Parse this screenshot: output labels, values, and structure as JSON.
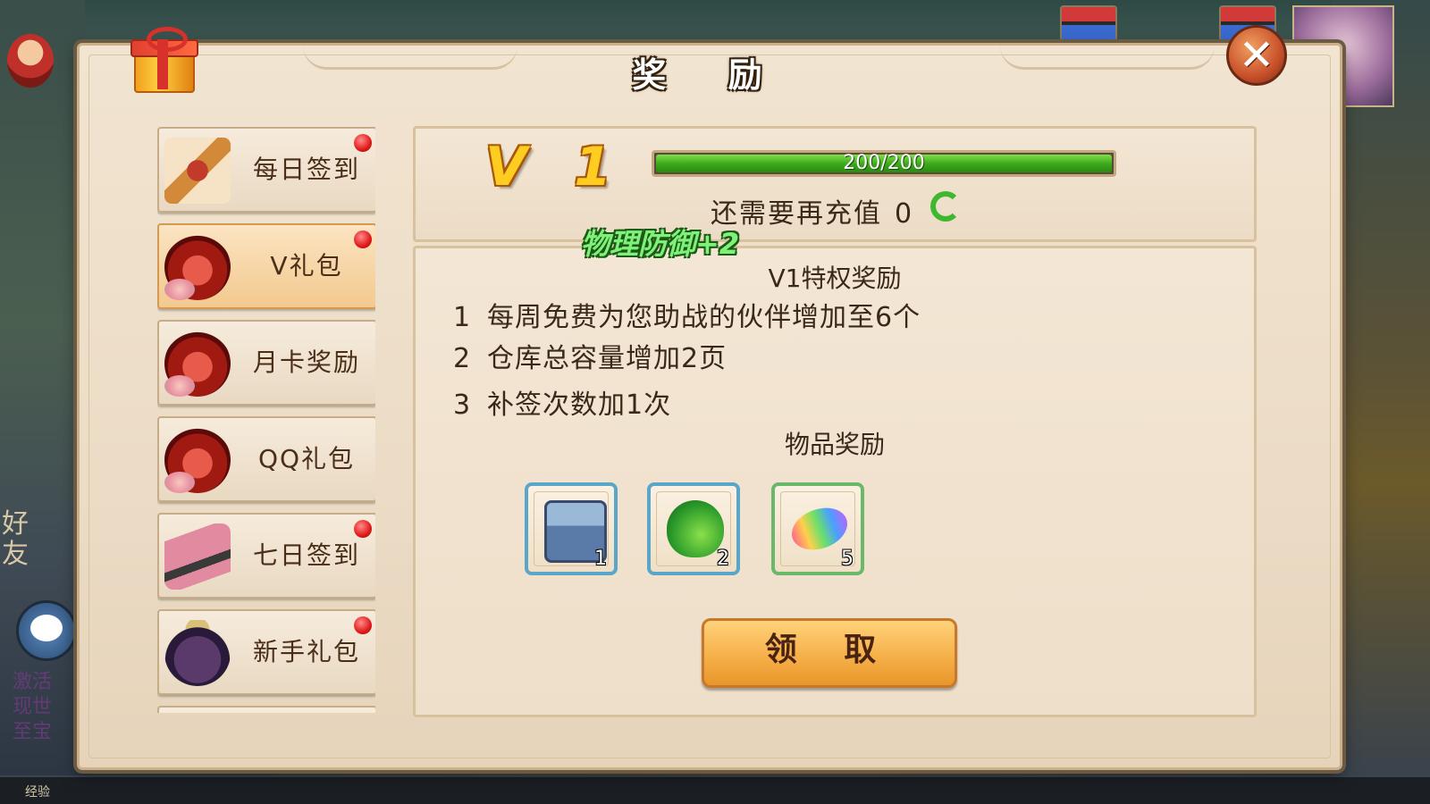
{
  "hud": {
    "exp_label": "经验",
    "side_text": "好友",
    "chat_log": [
      "激活",
      "现世",
      "至宝"
    ]
  },
  "dialog": {
    "title": "奖 励",
    "close_symbol": "✕"
  },
  "sidebar": {
    "items": [
      {
        "label": "每日签到",
        "icon": "scroll-icon",
        "badge": true,
        "active": false
      },
      {
        "label": "V礼包",
        "icon": "pot-icon",
        "badge": true,
        "active": true
      },
      {
        "label": "月卡奖励",
        "icon": "pot-icon",
        "badge": false,
        "active": false
      },
      {
        "label": "QQ礼包",
        "icon": "pot-icon",
        "badge": false,
        "active": false
      },
      {
        "label": "七日签到",
        "icon": "roll-icon",
        "badge": true,
        "active": false
      },
      {
        "label": "新手礼包",
        "icon": "bag-icon",
        "badge": true,
        "active": false
      }
    ]
  },
  "vip": {
    "level": "V 1",
    "progress_text": "200/200",
    "progress_fraction": 1.0,
    "recharge_label": "还需要再充值",
    "recharge_value": "0"
  },
  "floating_buff": "物理防御+2",
  "privileges": {
    "title": "V1特权奖励",
    "lines": [
      {
        "num": "1",
        "text": "每周免费为您助战的伙伴增加至6个"
      },
      {
        "num": "2",
        "text": "仓库总容量增加2页"
      },
      {
        "num": "3",
        "text": "补签次数加1次"
      }
    ]
  },
  "items_reward": {
    "title": "物品奖励",
    "items": [
      {
        "icon": "treasure-chest-icon",
        "count": "1",
        "frame": "blue"
      },
      {
        "icon": "gourd-icon",
        "count": "2",
        "frame": "blue"
      },
      {
        "icon": "rainbow-bean-icon",
        "count": "5",
        "frame": "green"
      }
    ]
  },
  "claim_button": "领 取",
  "colors": {
    "progress_green": "#3aa61a",
    "badge_red": "#e01a1a",
    "vip_gold": "#ffcc20",
    "button_orange": "#f6b04a"
  }
}
